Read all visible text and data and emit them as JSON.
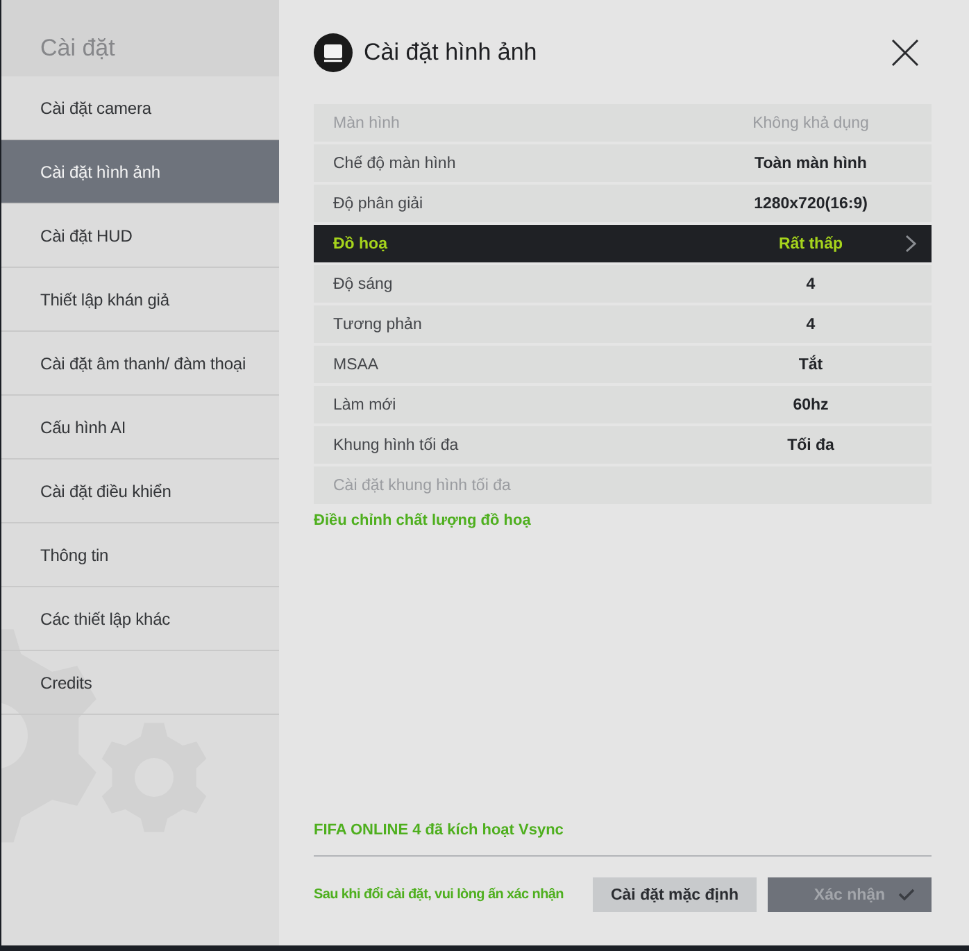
{
  "sidebar": {
    "title": "Cài đặt",
    "items": [
      {
        "label": "Cài đặt camera",
        "selected": false
      },
      {
        "label": "Cài đặt hình ảnh",
        "selected": true
      },
      {
        "label": "Cài đặt HUD",
        "selected": false
      },
      {
        "label": "Thiết lập khán giả",
        "selected": false
      },
      {
        "label": "Cài đặt âm thanh/ đàm thoại",
        "selected": false
      },
      {
        "label": "Cấu hình AI",
        "selected": false
      },
      {
        "label": "Cài đặt điều khiển",
        "selected": false
      },
      {
        "label": "Thông tin",
        "selected": false
      },
      {
        "label": "Các thiết lập khác",
        "selected": false
      },
      {
        "label": "Credits",
        "selected": false
      }
    ]
  },
  "panel": {
    "title": "Cài đặt hình ảnh",
    "rows": [
      {
        "label": "Màn hình",
        "value": "Không khả dụng",
        "disabled": true,
        "selected": false
      },
      {
        "label": "Chế độ màn hình",
        "value": "Toàn màn hình",
        "disabled": false,
        "selected": false
      },
      {
        "label": "Độ phân giải",
        "value": "1280x720(16:9)",
        "disabled": false,
        "selected": false
      },
      {
        "label": "Đồ hoạ",
        "value": "Rất thấp",
        "disabled": false,
        "selected": true
      },
      {
        "label": "Độ sáng",
        "value": "4",
        "disabled": false,
        "selected": false
      },
      {
        "label": "Tương phản",
        "value": "4",
        "disabled": false,
        "selected": false
      },
      {
        "label": "MSAA",
        "value": "Tắt",
        "disabled": false,
        "selected": false
      },
      {
        "label": "Làm mới",
        "value": "60hz",
        "disabled": false,
        "selected": false
      },
      {
        "label": "Khung hình tối đa",
        "value": "Tối đa",
        "disabled": false,
        "selected": false
      },
      {
        "label": "Cài đặt khung hình tối đa",
        "disabled": true,
        "selected": false
      }
    ],
    "hint": "Điều chỉnh chất lượng đồ hoạ",
    "vsync_note": "FIFA ONLINE 4 đã kích hoạt Vsync"
  },
  "footer": {
    "message": "Sau khi đổi cài đặt, vui lòng ấn xác nhận",
    "buttons": [
      {
        "kind": "default",
        "label": "Cài đặt mặc định",
        "disabled": false
      },
      {
        "kind": "confirm",
        "label": "Xác nhận",
        "disabled": true
      }
    ]
  }
}
